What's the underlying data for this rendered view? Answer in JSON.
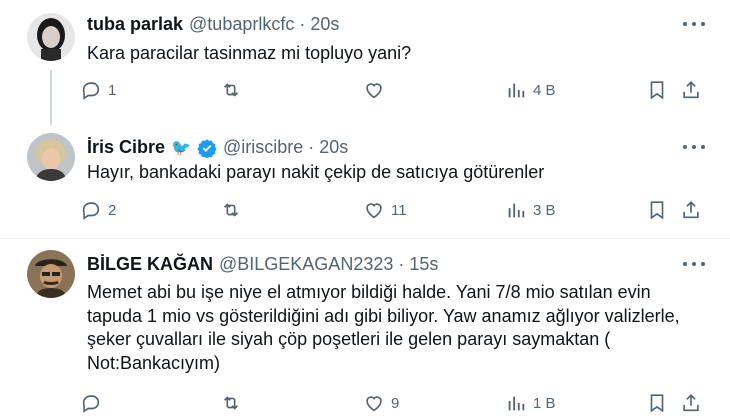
{
  "tweets": [
    {
      "name": "tuba parlak",
      "handle": "@tubaprlkcfc",
      "dot": "·",
      "time": "20s",
      "text": "Kara paracilar tasinmaz mi topluyo yani?",
      "replies": "1",
      "retweets": "",
      "likes": "",
      "views": "4 B"
    },
    {
      "name": "İris Cibre",
      "emoji": "🐦",
      "verified": true,
      "handle": "@iriscibre",
      "dot": "·",
      "time": "20s",
      "text": "Hayır, bankadaki parayı nakit çekip de satıcıya götürenler",
      "replies": "2",
      "retweets": "",
      "likes": "11",
      "views": "3 B"
    },
    {
      "name": "BİLGE KAĞAN",
      "handle": "@BILGEKAGAN2323",
      "dot": "·",
      "time": "15s",
      "text": "Memet abi bu işe niye el atmıyor bildiği halde. Yani 7/8 mio satılan evin\ntapuda 1 mio vs gösterildiğini adı gibi biliyor. Yaw anamız ağlıyor valizlerle,\nşeker çuvalları ile siyah çöp poşetleri ile gelen parayı saymaktan (\nNot:Bankacıyım)",
      "replies": "",
      "retweets": "",
      "likes": "9",
      "views": "1 B"
    }
  ],
  "colors": {
    "text": "#0f1419",
    "secondary": "#536471",
    "verified": "#1d9bf0",
    "thread_line": "#cfd9de"
  },
  "icons": [
    "reply-icon",
    "retweet-icon",
    "like-icon",
    "views-icon",
    "bookmark-icon",
    "share-icon",
    "more-icon",
    "verified-badge-icon"
  ]
}
